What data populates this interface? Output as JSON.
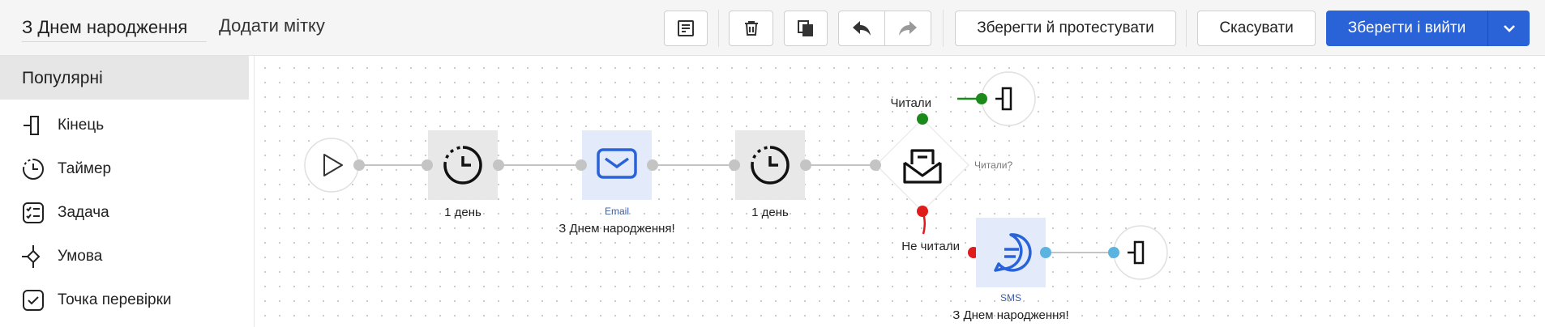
{
  "header": {
    "campaign_name": "З Днем народження",
    "add_tag": "Додати мітку",
    "save_and_test": "Зберегти й протестувати",
    "cancel": "Скасувати",
    "save_and_exit": "Зберегти і вийти"
  },
  "sidebar": {
    "section_title": "Популярні",
    "items": [
      {
        "label": "Кінець",
        "icon": "end-icon"
      },
      {
        "label": "Таймер",
        "icon": "timer-icon"
      },
      {
        "label": "Задача",
        "icon": "task-icon"
      },
      {
        "label": "Умова",
        "icon": "condition-icon"
      },
      {
        "label": "Точка перевірки",
        "icon": "checkpoint-icon"
      }
    ]
  },
  "flow": {
    "timer1_label": "1 день",
    "email_type": "Email",
    "email_label": "З Днем народження!",
    "timer2_label": "1 день",
    "condition_label": "Читали?",
    "branch_yes": "Читали",
    "branch_no": "Не читали",
    "sms_type": "SMS",
    "sms_label": "З Днем народження!"
  },
  "colors": {
    "primary": "#2a63d8",
    "branch_yes": "#1b8a1b",
    "branch_no": "#e01b1b",
    "sms_connector": "#5bb3e0",
    "channel_node_bg": "#e3ebfb",
    "timer_node_bg": "#e8e8e8"
  }
}
